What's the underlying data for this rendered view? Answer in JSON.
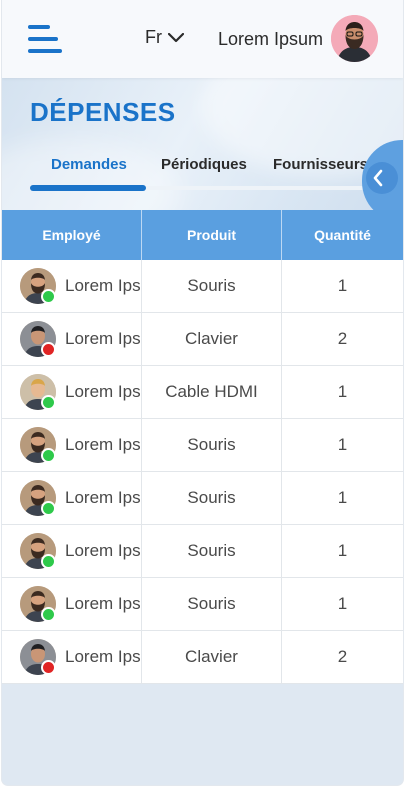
{
  "header": {
    "language": "Fr",
    "username": "Lorem Ipsum"
  },
  "page": {
    "title": "DÉPENSES"
  },
  "tabs": [
    {
      "label": "Demandes",
      "active": true
    },
    {
      "label": "Périodiques",
      "active": false
    },
    {
      "label": "Fournisseurs",
      "active": false
    }
  ],
  "table": {
    "headers": [
      "Employé",
      "Produit",
      "Quantité"
    ],
    "rows": [
      {
        "employee": "Lorem Ipsum",
        "product": "Souris",
        "quantity": "1",
        "status": "online"
      },
      {
        "employee": "Lorem Ipsum",
        "product": "Clavier",
        "quantity": "2",
        "status": "busy"
      },
      {
        "employee": "Lorem Ipsum",
        "product": "Cable HDMI",
        "quantity": "1",
        "status": "online"
      },
      {
        "employee": "Lorem Ipsum",
        "product": "Souris",
        "quantity": "1",
        "status": "online"
      },
      {
        "employee": "Lorem Ipsum",
        "product": "Souris",
        "quantity": "1",
        "status": "online"
      },
      {
        "employee": "Lorem Ipsum",
        "product": "Souris",
        "quantity": "1",
        "status": "online"
      },
      {
        "employee": "Lorem Ipsum",
        "product": "Souris",
        "quantity": "1",
        "status": "online"
      },
      {
        "employee": "Lorem Ipsum",
        "product": "Clavier",
        "quantity": "2",
        "status": "busy"
      }
    ]
  },
  "colors": {
    "accent": "#1a73c9",
    "table_header": "#5a9fe0",
    "status_online": "#2ec94a",
    "status_busy": "#e02424"
  },
  "icons": {
    "menu": "hamburger-icon",
    "language_dropdown": "chevron-down-icon",
    "side_toggle": "chevron-left-icon"
  }
}
